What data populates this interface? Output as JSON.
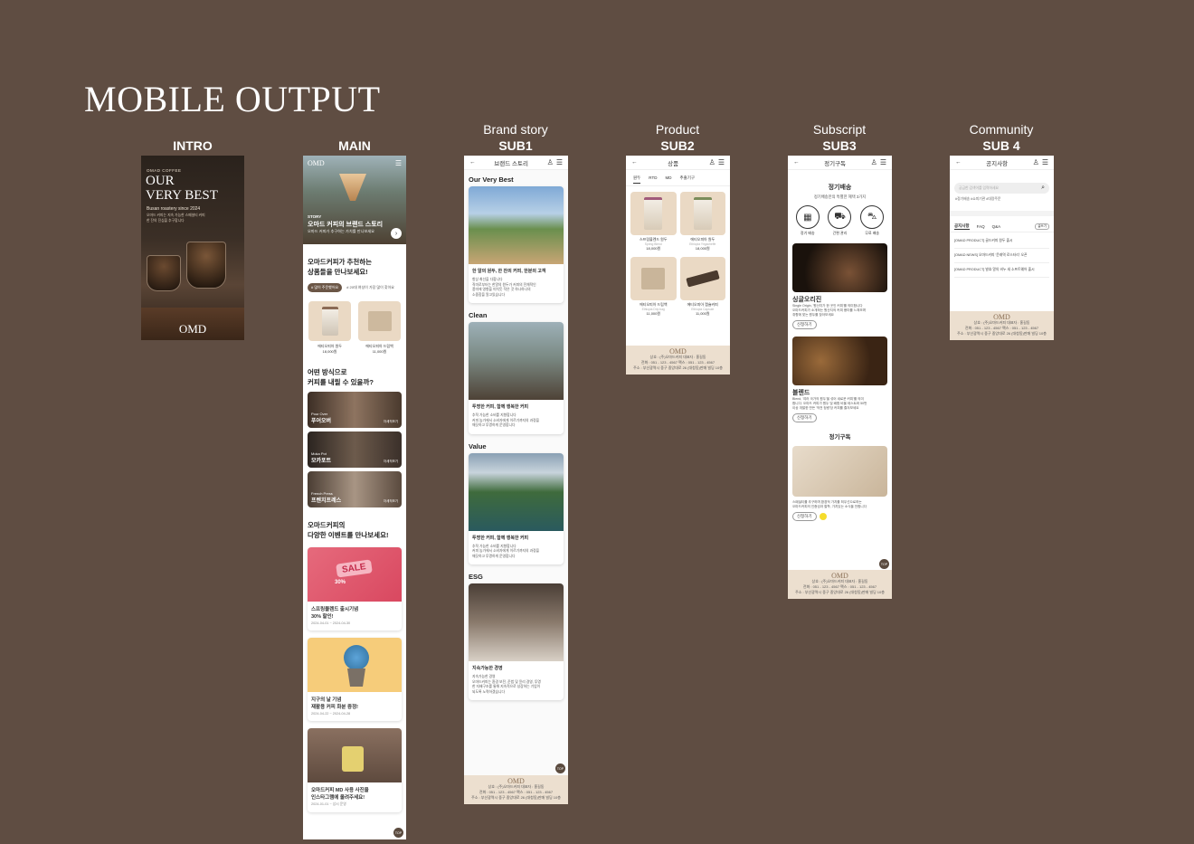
{
  "page_title": "MOBILE OUTPUT",
  "columns": {
    "intro": "INTRO",
    "main": "MAIN",
    "sub1": {
      "top": "Brand story",
      "bottom": "SUB1"
    },
    "sub2": {
      "top": "Product",
      "bottom": "SUB2"
    },
    "sub3": {
      "top": "Subscript",
      "bottom": "SUB3"
    },
    "sub4": {
      "top": "Community",
      "bottom": "SUB 4"
    }
  },
  "intro": {
    "brand": "OMAD COFFEE",
    "headline1": "OUR",
    "headline2": "VERY BEST",
    "tagline": "Busan roastery since 2024",
    "desc1": "오마드 커피는 지속 가능한 스페셜티 커피",
    "desc2": "한 잔의 진심을 추구합니다",
    "logo": "OMD"
  },
  "main": {
    "logo": "OMD",
    "hero_tag": "STORY",
    "hero_title": "오마드 커피의 브랜드 스토리",
    "hero_sub": "오마드 커피가 추구하는 가치를 만나보세요",
    "rec_title1": "오마드커피가 추천하는",
    "rec_title2": "상품들을 만나보세요!",
    "chip1": "# 많이 주문했어요",
    "chip2": "# 20대 여성이 가장 많이 찾아요",
    "products": [
      {
        "name": "에티오피아 원두",
        "price": "18,000원"
      },
      {
        "name": "에티오피아 드립백",
        "price": "11,000원"
      }
    ],
    "brew_title1": "어떤 방식으로",
    "brew_title2": "커피를 내릴 수 있을까?",
    "brews": [
      {
        "en": "Pour Over",
        "ko": "푸어오버",
        "more": "자세히보기"
      },
      {
        "en": "Moka Pot",
        "ko": "모카포트",
        "more": "자세히보기"
      },
      {
        "en": "French Press",
        "ko": "프렌치프레스",
        "more": "자세히보기"
      }
    ],
    "event_title1": "오마드커피의",
    "event_title2": "다양한 이벤트를 만나보세요!",
    "events": [
      {
        "title1": "스프링블렌드 출시기념",
        "title2": "30% 할인!",
        "date": "2024-04-01 ~ 2024-04-30",
        "badge": "SALE",
        "pct": "30%"
      },
      {
        "title1": "지구의 날 기념",
        "title2": "재활용 커피 화분 증정!",
        "date": "2024-04-22 ~ 2024-04-28",
        "badge": "",
        "pct": ""
      },
      {
        "title1": "오마드커피 MD 사용 사진을",
        "title2": "인스타그램에 올려주세요!",
        "date": "2024-01-01 ~ 상시 운영",
        "badge": "",
        "pct": ""
      }
    ],
    "top": "TOP"
  },
  "sub1": {
    "header": "브랜드 스토리",
    "sections": [
      {
        "label": "Our Very Best",
        "title": "한 알의 원두, 한 잔의 커피, 한분의 고객",
        "lines": [
          "항상 최선을 다합니다",
          "직미로부터는 한알의 원두가 커피의 전체적인",
          "풍미에 영향을 미치듯 작은 것 하나하나의",
          "소중함을 알고있습니다"
        ]
      },
      {
        "label": "Clean",
        "title": "투명한 커피, 함께 행복한 커피",
        "lines": [
          "추적 가능한 소비를 지향합니다",
          "커피 농가에서 소비자에게 이르기까지의 과정을",
          "깨끗하고 투명하게 운영합니다"
        ]
      },
      {
        "label": "Value",
        "title": "투명한 커피, 함께 행복한 커피",
        "lines": [
          "추적 가능한 소비를 지향합니다",
          "커피 농가에서 소비자에게 이르기까지의 과정을",
          "깨끗하고 투명하게 운영합니다"
        ]
      },
      {
        "label": "ESG",
        "title": "지속가능한 경영",
        "lines": [
          "지속가능한 경영",
          "오마드커피는 환경 보전, 준법 및 윤리 경영, 투명",
          "한 지배구조를 통해 지속적으로 성장하는 기업이",
          "되도록 노력하겠습니다"
        ]
      }
    ],
    "top": "TOP"
  },
  "footer": {
    "logo": "OMD",
    "line1": "상호 : (주)오마드커피   대표자 : 홍길동",
    "line2": "전화 : 051 - 123 - 4567   팩스 : 051 - 123 - 4567",
    "line3": "주소 : 부산광역시 중구 중앙대로 26 (대청동)판매 빌딩 10층"
  },
  "sub2": {
    "header": "상품",
    "tabs": [
      "원두",
      "RTD",
      "MD",
      "추출기구"
    ],
    "items": [
      {
        "name": "스프링블렌드 원두",
        "sub": "Spring Blend",
        "price": "18,000원"
      },
      {
        "name": "에티오피아 원두",
        "sub": "Ethiopia Yirgacheffe",
        "price": "18,000원"
      },
      {
        "name": "에티오피아 드립백",
        "sub": "Ethiopia Drip bag",
        "price": "11,000원"
      },
      {
        "name": "에티오피아 캡슐커피",
        "sub": "Ethiopia Capsule",
        "price": "11,000원"
      }
    ]
  },
  "sub3": {
    "header": "정기구독",
    "title": "정기배송",
    "subtitle": "정기배송만의 특별한 혜택 3가지",
    "benefits": [
      "정기 배송",
      "간편 관리",
      "무료 배송"
    ],
    "single_title": "싱글오리진",
    "single_lines": [
      "Single Origin, '원산지가 한 곳인 커피'를 의미합니다",
      "오마드커피가 소개하는 원산지의 커피 풍미를 느껴보며",
      "취향에 맞는 원두를 찾아보세요"
    ],
    "blend_title": "블렌드",
    "blend_lines": [
      "Blend, '여러 국가의 원두'을 섞어 새로운 커피'를 의미",
      "합니다. 오마드 커피가 원두 및 배합 비율 테스트와 50번",
      "이상 개발한 만든 '작전 정량'당 커피를 즐겨보세요"
    ],
    "apply": "신청하기",
    "sub_title": "정기구독",
    "sub_lines": [
      "스페셜티를 추구하며 환경적 가치를 최우선으로하는",
      "오마드커피의 인증성과 철학, 가치있는 소식을 전합니다"
    ],
    "top": "TOP"
  },
  "sub4": {
    "header": "공지사항",
    "search_placeholder": "궁금한 검색어를 입력하세요",
    "tags": "#정기배송  #쇼피기관  #대량주문",
    "tabs": [
      "공지사항",
      "FAQ",
      "Q&A"
    ],
    "write": "글쓰기",
    "posts": [
      "[OMAD PRODUCT] 골드커피 원두 출시",
      "[OMAD NEWS] 오마드커피 '문래역 로스터리' 오픈",
      "[OMAD PRODUCT] 발효 알의 비누 새 소프트웨어 출시"
    ]
  }
}
